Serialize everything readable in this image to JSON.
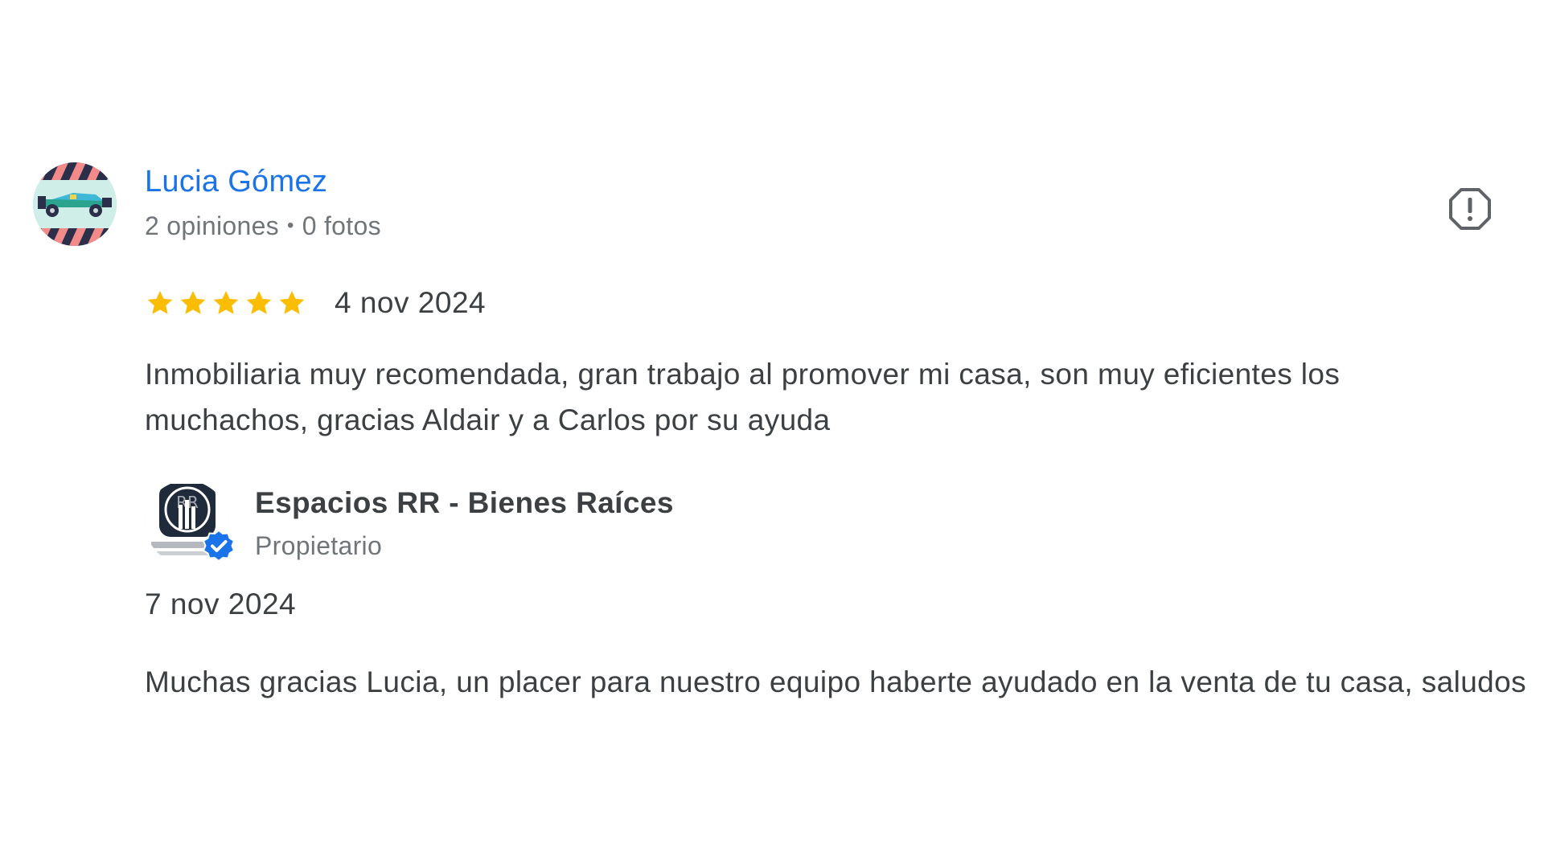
{
  "review": {
    "author": {
      "name": "Lucia Gómez",
      "reviews_count": "2 opiniones",
      "separator": "•",
      "photos_count": "0 fotos",
      "avatar_icon": "race-car-avatar-icon"
    },
    "report_icon": "flag-report-icon",
    "rating": {
      "value": 5,
      "max": 5,
      "star_color": "#fbbc04"
    },
    "date": "4 nov 2024",
    "text": "Inmobiliaria muy recomendada, gran trabajo al promover mi casa, son muy eficientes los muchachos, gracias Aldair y a Carlos por su ayuda"
  },
  "owner_response": {
    "name": "Espacios RR - Bienes Raíces",
    "role": "Propietario",
    "logo_icon": "espacios-rr-logo-icon",
    "verified_icon": "verified-check-icon",
    "verified_color": "#1a73e8",
    "date": "7 nov 2024",
    "text": "Muchas gracias Lucia, un placer para nuestro equipo haberte ayudado en la venta de tu casa, saludos"
  },
  "colors": {
    "author_name": "#1a73e8",
    "body_text": "#3c4043",
    "secondary_text": "#70757a"
  }
}
